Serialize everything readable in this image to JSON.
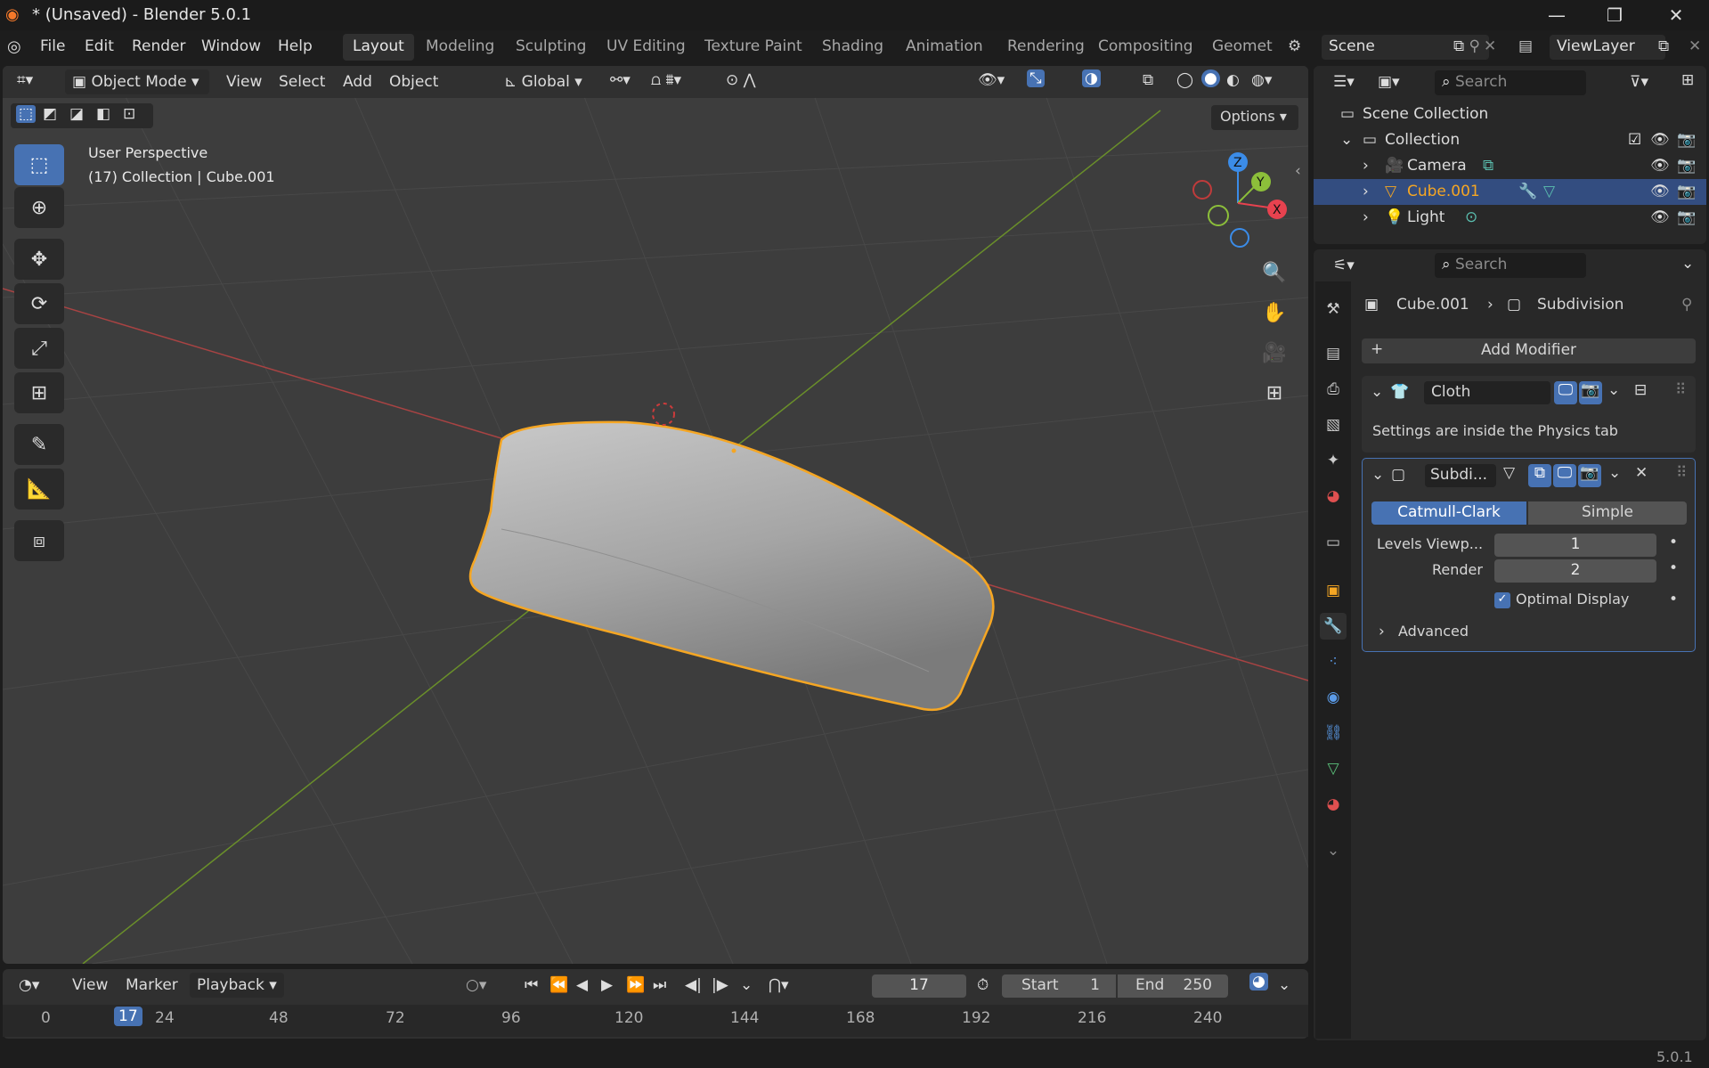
{
  "window": {
    "title": "* (Unsaved) - Blender 5.0.1"
  },
  "menus": [
    "File",
    "Edit",
    "Render",
    "Window",
    "Help"
  ],
  "workspaces": [
    "Layout",
    "Modeling",
    "Sculpting",
    "UV Editing",
    "Texture Paint",
    "Shading",
    "Animation",
    "Rendering",
    "Compositing",
    "Geometr"
  ],
  "scene": {
    "name": "Scene",
    "view_layer": "ViewLayer"
  },
  "viewport": {
    "mode": "Object Mode",
    "menu": [
      "View",
      "Select",
      "Add",
      "Object"
    ],
    "orientation": "Global",
    "options": "Options",
    "perspective": "User Perspective",
    "info": "(17) Collection | Cube.001",
    "gizmo": {
      "x": "X",
      "y": "Y",
      "z": "Z"
    }
  },
  "outliner": {
    "search_placeholder": "Search",
    "scene_collection": "Scene Collection",
    "collection": "Collection",
    "items": [
      "Camera",
      "Cube.001",
      "Light"
    ]
  },
  "properties": {
    "search_placeholder": "Search",
    "breadcrumb_object": "Cube.001",
    "breadcrumb_modifier": "Subdivision",
    "add_modifier": "Add Modifier",
    "cloth": {
      "name": "Cloth",
      "note": "Settings are inside the Physics tab"
    },
    "subdiv": {
      "name": "Subdi...",
      "mode_a": "Catmull-Clark",
      "mode_b": "Simple",
      "levels_label": "Levels Viewp...",
      "levels_value": "1",
      "render_label": "Render",
      "render_value": "2",
      "optimal_label": "Optimal Display",
      "optimal_checked": true,
      "advanced": "Advanced"
    }
  },
  "timeline": {
    "menu": [
      "View",
      "Marker",
      "Playback"
    ],
    "current_frame": "17",
    "start_label": "Start",
    "start_value": "1",
    "end_label": "End",
    "end_value": "250",
    "ticks": [
      "0",
      "24",
      "48",
      "72",
      "96",
      "120",
      "144",
      "168",
      "192",
      "216",
      "240"
    ],
    "playhead": "17"
  },
  "status": {
    "version": "5.0.1"
  },
  "colors": {
    "accent": "#4772b3",
    "selection": "#f5a623",
    "x_axis": "#e8424f",
    "y_axis": "#8cbf3a",
    "z_axis": "#3b8ce8"
  }
}
